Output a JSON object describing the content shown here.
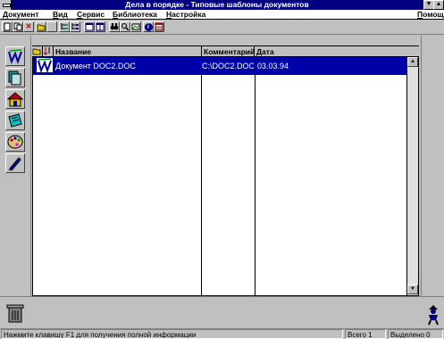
{
  "window": {
    "title": "Дела в порядке - Типовые шаблоны документов",
    "minimize_glyph": "▼",
    "maximize_glyph": "▲"
  },
  "menu": {
    "items": [
      "Документ",
      "Вид",
      "Сервис",
      "Библиотека",
      "Настройка"
    ],
    "help": "Помощь"
  },
  "toolbar": {
    "icons": [
      "new-document-icon",
      "document-copy-icon",
      "delete-icon",
      "folder-icon",
      "blank-icon",
      "tree-view-icon",
      "tree-view-2-icon",
      "window-icon",
      "window-split-icon",
      "find-binoculars-icon",
      "search-icon",
      "picture-icon",
      "info-icon",
      "calendar-icon"
    ],
    "delete_glyph": "✕",
    "info_glyph": "i"
  },
  "sidebar": {
    "icons": [
      "letters-icon",
      "document-stack-icon",
      "house-icon",
      "notebook-icon",
      "palette-icon",
      "pen-icon"
    ]
  },
  "list": {
    "columns": [
      "Название",
      "Комментарий",
      "Дата"
    ],
    "rows": [
      {
        "name": "Документ DOC2.DOC",
        "comment": "C:\\DOC2.DOC",
        "date": "03.03.94"
      }
    ],
    "selected_row_color": "#0000a8"
  },
  "bottom": {
    "trash_icon": "trash-can-icon",
    "figure_icon": "little-man-icon"
  },
  "status": {
    "hint": "Нажмите клавишу F1 для получения полной информации",
    "total": "Всего 1",
    "selected": "Выделено 0"
  }
}
